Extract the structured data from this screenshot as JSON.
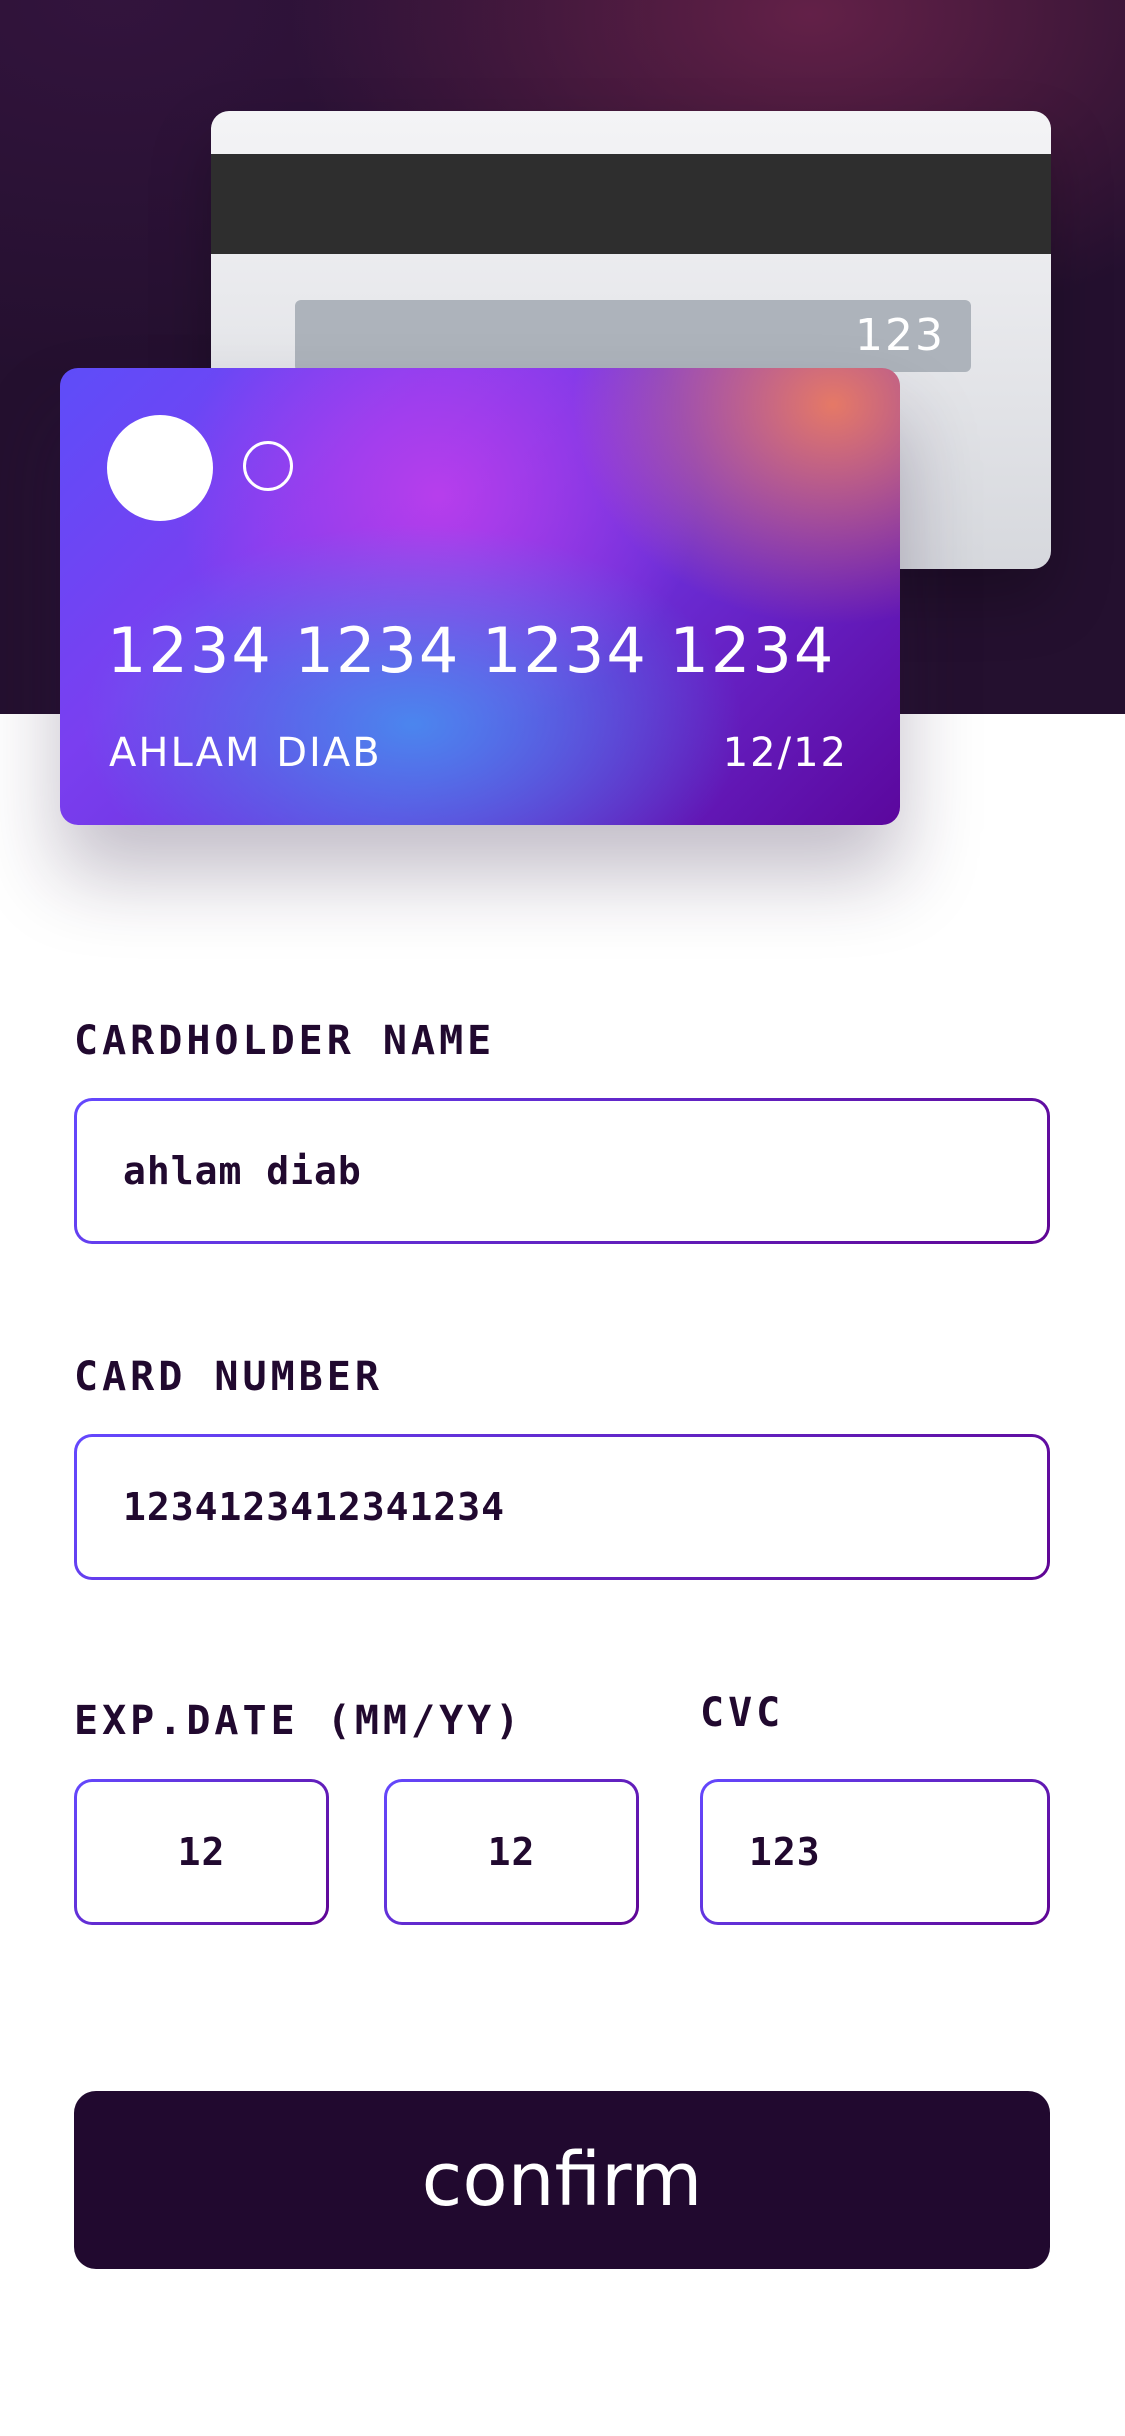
{
  "card_preview": {
    "back": {
      "cvc": "123"
    },
    "front": {
      "number": "1234 1234 1234 1234",
      "holder": "AHLAM DIAB",
      "expiry": "12/12"
    }
  },
  "form": {
    "cardholder": {
      "label": "CARDHOLDER NAME",
      "value": "ahlam diab"
    },
    "card_number": {
      "label": "CARD NUMBER",
      "value": "1234123412341234"
    },
    "exp_date": {
      "label": "EXP.DATE (MM/YY)",
      "month": "12",
      "year": "12"
    },
    "cvc": {
      "label": "CVC",
      "value": "123"
    },
    "confirm_label": "confirm"
  },
  "colors": {
    "dark": "#21092f",
    "border_start": "#6448fe",
    "border_end": "#600594"
  },
  "icons": [
    "card-logo-filled-circle",
    "card-logo-outline-circle"
  ]
}
